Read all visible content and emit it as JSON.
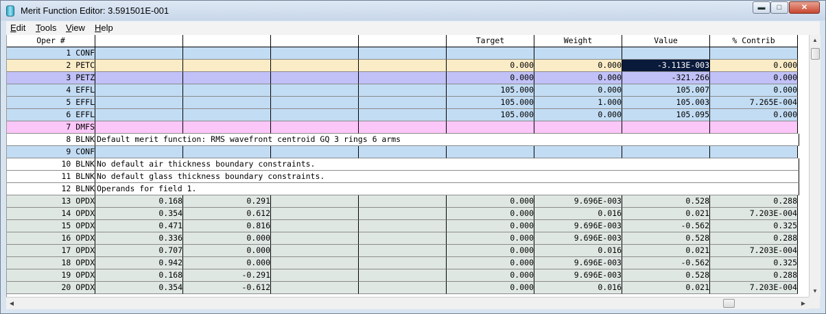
{
  "window": {
    "title": "Merit Function Editor: 3.591501E-001"
  },
  "menu": [
    {
      "label": "Edit",
      "ul": "E",
      "rest": "dit"
    },
    {
      "label": "Tools",
      "ul": "T",
      "rest": "ools"
    },
    {
      "label": "View",
      "ul": "V",
      "rest": "iew"
    },
    {
      "label": "Help",
      "ul": "H",
      "rest": "elp"
    }
  ],
  "colors": {
    "CONF": "#c2dcf3",
    "PETC": "#faecc6",
    "PETZ": "#c1c1f8",
    "EFFL": "#c2dcf3",
    "DMFS": "#fbc6f8",
    "BLNK": "#ffffff",
    "OPDX": "#dfe7e2",
    "header": "#ffffff",
    "selected": "#0a1a3a"
  },
  "header": {
    "oper": "Oper #",
    "c1": "",
    "c2": "",
    "c3": "",
    "c4": "",
    "target": "Target",
    "weight": "Weight",
    "value": "Value",
    "contrib": "% Contrib"
  },
  "rows": [
    {
      "num": "1",
      "type": "CONF",
      "c1": "",
      "c2": "",
      "c3": "",
      "c4": "",
      "target": "",
      "weight": "",
      "value": "",
      "contrib": ""
    },
    {
      "num": "2",
      "type": "PETC",
      "c1": "",
      "c2": "",
      "c3": "",
      "c4": "",
      "target": "0.000",
      "weight": "0.000",
      "value": "-3.113E-003",
      "contrib": "0.000",
      "selected": "value"
    },
    {
      "num": "3",
      "type": "PETZ",
      "c1": "",
      "c2": "",
      "c3": "",
      "c4": "",
      "target": "0.000",
      "weight": "0.000",
      "value": "-321.266",
      "contrib": "0.000"
    },
    {
      "num": "4",
      "type": "EFFL",
      "c1": "",
      "c2": "",
      "c3": "",
      "c4": "",
      "target": "105.000",
      "weight": "0.000",
      "value": "105.007",
      "contrib": "0.000"
    },
    {
      "num": "5",
      "type": "EFFL",
      "c1": "",
      "c2": "",
      "c3": "",
      "c4": "",
      "target": "105.000",
      "weight": "1.000",
      "value": "105.003",
      "contrib": "7.265E-004"
    },
    {
      "num": "6",
      "type": "EFFL",
      "c1": "",
      "c2": "",
      "c3": "",
      "c4": "",
      "target": "105.000",
      "weight": "0.000",
      "value": "105.095",
      "contrib": "0.000"
    },
    {
      "num": "7",
      "type": "DMFS",
      "c1": "",
      "c2": "",
      "c3": "",
      "c4": "",
      "target": "",
      "weight": "",
      "value": "",
      "contrib": ""
    },
    {
      "num": "8",
      "type": "BLNK",
      "comment": "Default merit function: RMS wavefront centroid GQ 3 rings 6 arms"
    },
    {
      "num": "9",
      "type": "CONF",
      "c1": "",
      "c2": "",
      "c3": "",
      "c4": "",
      "target": "",
      "weight": "",
      "value": "",
      "contrib": ""
    },
    {
      "num": "10",
      "type": "BLNK",
      "comment": "No default air thickness boundary constraints."
    },
    {
      "num": "11",
      "type": "BLNK",
      "comment": "No default glass thickness boundary constraints."
    },
    {
      "num": "12",
      "type": "BLNK",
      "comment": "Operands for field 1."
    },
    {
      "num": "13",
      "type": "OPDX",
      "c1": "0.168",
      "c2": "0.291",
      "c3": "",
      "c4": "",
      "target": "0.000",
      "weight": "9.696E-003",
      "value": "0.528",
      "contrib": "0.288"
    },
    {
      "num": "14",
      "type": "OPDX",
      "c1": "0.354",
      "c2": "0.612",
      "c3": "",
      "c4": "",
      "target": "0.000",
      "weight": "0.016",
      "value": "0.021",
      "contrib": "7.203E-004"
    },
    {
      "num": "15",
      "type": "OPDX",
      "c1": "0.471",
      "c2": "0.816",
      "c3": "",
      "c4": "",
      "target": "0.000",
      "weight": "9.696E-003",
      "value": "-0.562",
      "contrib": "0.325"
    },
    {
      "num": "16",
      "type": "OPDX",
      "c1": "0.336",
      "c2": "0.000",
      "c3": "",
      "c4": "",
      "target": "0.000",
      "weight": "9.696E-003",
      "value": "0.528",
      "contrib": "0.288"
    },
    {
      "num": "17",
      "type": "OPDX",
      "c1": "0.707",
      "c2": "0.000",
      "c3": "",
      "c4": "",
      "target": "0.000",
      "weight": "0.016",
      "value": "0.021",
      "contrib": "7.203E-004"
    },
    {
      "num": "18",
      "type": "OPDX",
      "c1": "0.942",
      "c2": "0.000",
      "c3": "",
      "c4": "",
      "target": "0.000",
      "weight": "9.696E-003",
      "value": "-0.562",
      "contrib": "0.325"
    },
    {
      "num": "19",
      "type": "OPDX",
      "c1": "0.168",
      "c2": "-0.291",
      "c3": "",
      "c4": "",
      "target": "0.000",
      "weight": "9.696E-003",
      "value": "0.528",
      "contrib": "0.288"
    },
    {
      "num": "20",
      "type": "OPDX",
      "c1": "0.354",
      "c2": "-0.612",
      "c3": "",
      "c4": "",
      "target": "0.000",
      "weight": "0.016",
      "value": "0.021",
      "contrib": "7.203E-004"
    }
  ]
}
